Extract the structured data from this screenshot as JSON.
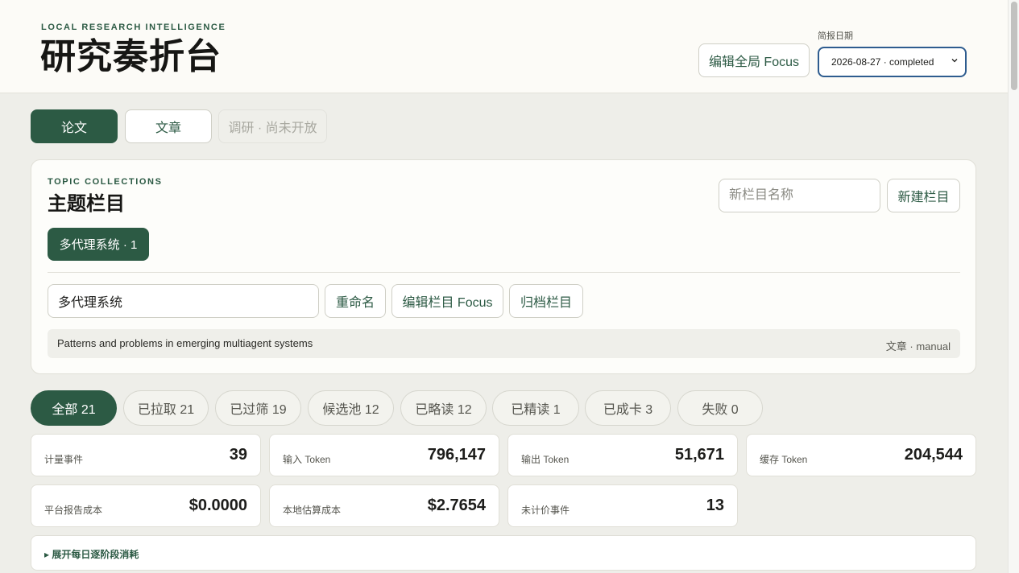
{
  "header": {
    "eyebrow": "LOCAL RESEARCH INTELLIGENCE",
    "title": "研究奏折台",
    "global_focus_button": "编辑全局 Focus",
    "date_label": "简报日期",
    "date_value": "2026-08-27 · completed"
  },
  "type_tabs": [
    {
      "label": "论文",
      "state": "active"
    },
    {
      "label": "文章",
      "state": "normal"
    },
    {
      "label": "调研 · 尚未开放",
      "state": "disabled"
    }
  ],
  "topics": {
    "eyebrow": "TOPIC COLLECTIONS",
    "title": "主题栏目",
    "new_name_placeholder": "新栏目名称",
    "new_button": "新建栏目",
    "chip": "多代理系统 · 1",
    "name_value": "多代理系统",
    "rename_button": "重命名",
    "focus_button": "编辑栏目 Focus",
    "archive_button": "归档栏目",
    "description": "Patterns and problems in emerging multiagent systems",
    "description_meta": "文章 · manual"
  },
  "filters": [
    {
      "label": "全部 21",
      "state": "active"
    },
    {
      "label": "已拉取 21",
      "state": "normal"
    },
    {
      "label": "已过筛 19",
      "state": "normal"
    },
    {
      "label": "候选池 12",
      "state": "normal"
    },
    {
      "label": "已略读 12",
      "state": "normal"
    },
    {
      "label": "已精读 1",
      "state": "normal"
    },
    {
      "label": "已成卡 3",
      "state": "normal"
    },
    {
      "label": "失败 0",
      "state": "normal"
    }
  ],
  "metrics": [
    {
      "label": "计量事件",
      "value": "39"
    },
    {
      "label": "输入 Token",
      "value": "796,147"
    },
    {
      "label": "输出 Token",
      "value": "51,671"
    },
    {
      "label": "缓存 Token",
      "value": "204,544"
    },
    {
      "label": "平台报告成本",
      "value": "$0.0000"
    },
    {
      "label": "本地估算成本",
      "value": "$2.7654"
    },
    {
      "label": "未计价事件",
      "value": "13"
    }
  ],
  "expand_label": "▸ 展开每日逐阶段消耗",
  "colors": {
    "accent": "#2c5a44",
    "page_bg": "#eeeee9",
    "header_bg": "#fcfbf7",
    "select_border": "#2e5c8f"
  }
}
